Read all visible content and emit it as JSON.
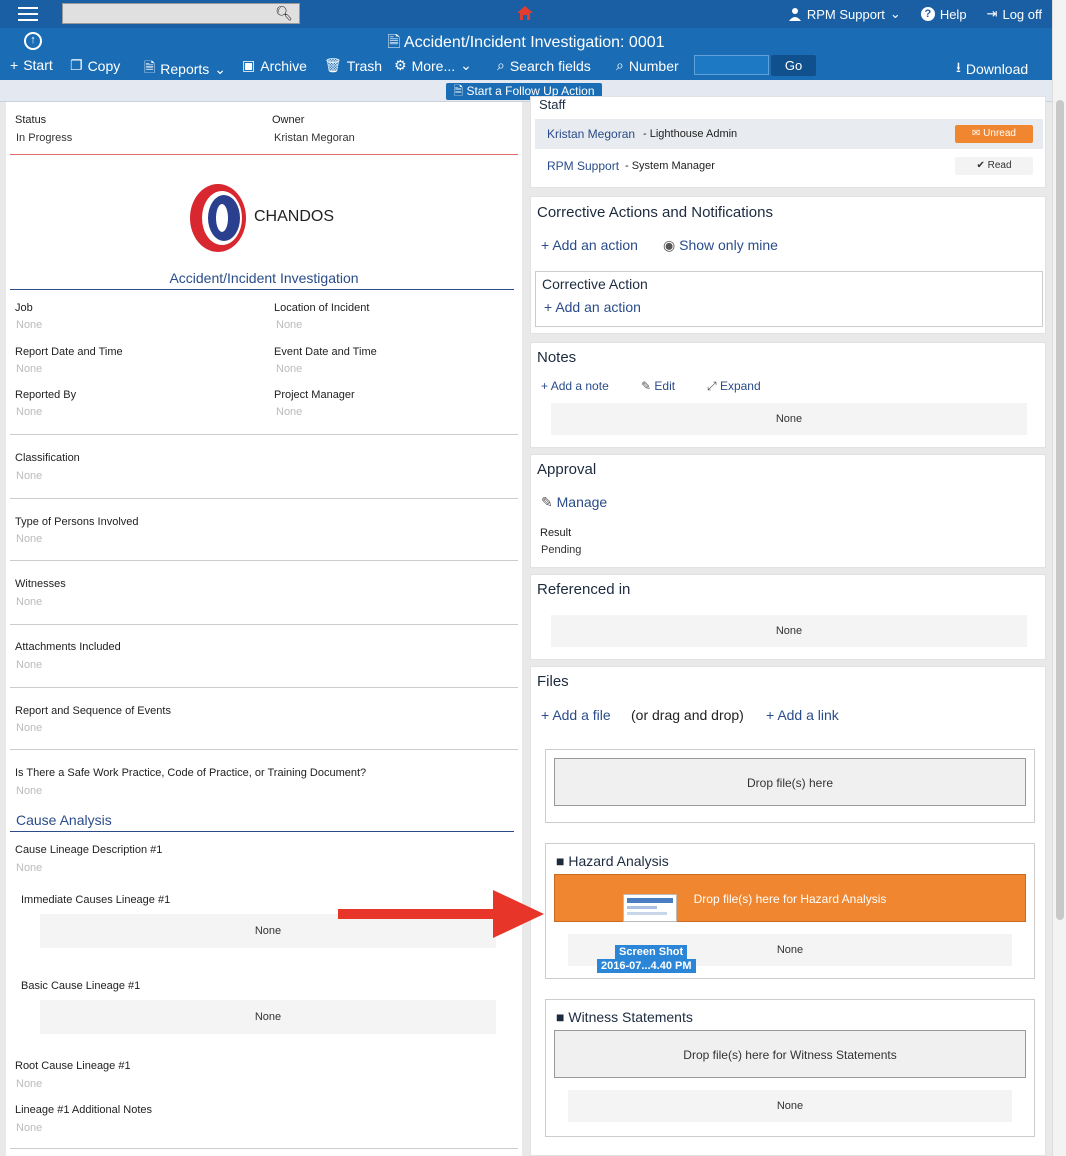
{
  "topbar": {
    "search_placeholder": "",
    "user": "RPM Support",
    "help": "Help",
    "logoff": "Log off"
  },
  "titlebar": {
    "title": "Accident/Incident Investigation: 0001"
  },
  "toolbar": {
    "start": "Start",
    "copy": "Copy",
    "reports": "Reports",
    "archive": "Archive",
    "trash": "Trash",
    "more": "More...",
    "search_fields": "Search fields",
    "number": "Number",
    "go": "Go",
    "download": "Download"
  },
  "follow_up": "Start a Follow Up Action",
  "form": {
    "status_label": "Status",
    "status_value": "In Progress",
    "owner_label": "Owner",
    "owner_value": "Kristan Megoran",
    "logo_text": "CHANDOS",
    "form_title": "Accident/Incident Investigation",
    "fields": [
      {
        "label": "Job",
        "value": "None"
      },
      {
        "label": "Location of Incident",
        "value": "None"
      },
      {
        "label": "Report Date and Time",
        "value": "None"
      },
      {
        "label": "Event Date and Time",
        "value": "None"
      },
      {
        "label": "Reported By",
        "value": "None"
      },
      {
        "label": "Project Manager",
        "value": "None"
      },
      {
        "label": "Classification",
        "value": "None"
      },
      {
        "label": "Type of Persons Involved",
        "value": "None"
      },
      {
        "label": "Witnesses",
        "value": "None"
      },
      {
        "label": "Attachments Included",
        "value": "None"
      },
      {
        "label": "Report and Sequence of Events",
        "value": "None"
      },
      {
        "label": "Is There a Safe Work Practice, Code of Practice, or Training Document?",
        "value": "None"
      }
    ],
    "cause_analysis": "Cause Analysis",
    "cause_desc_label": "Cause Lineage Description #1",
    "cause_desc_value": "None",
    "immediate_label": "Immediate Causes Lineage #1",
    "immediate_value": "None",
    "basic_label": "Basic Cause Lineage #1",
    "basic_value": "None",
    "root_label": "Root Cause Lineage #1",
    "root_value": "None",
    "notes_label": "Lineage #1 Additional Notes",
    "notes_value": "None"
  },
  "staff": {
    "title": "Staff",
    "rows": [
      {
        "name": "Kristan Megoran",
        "role": "- Lighthouse Admin",
        "status": "Unread"
      },
      {
        "name": "RPM Support",
        "role": "- System Manager",
        "status": "Read"
      }
    ]
  },
  "corrective": {
    "title": "Corrective Actions and Notifications",
    "add_action": "Add an action",
    "show_mine": "Show only mine",
    "sub_title": "Corrective Action",
    "sub_add": "Add an action"
  },
  "notes": {
    "title": "Notes",
    "add": "Add a note",
    "edit": "Edit",
    "expand": "Expand",
    "value": "None"
  },
  "approval": {
    "title": "Approval",
    "manage": "Manage",
    "result_label": "Result",
    "result_value": "Pending"
  },
  "referenced": {
    "title": "Referenced in",
    "value": "None"
  },
  "files": {
    "title": "Files",
    "add_file": "Add a file",
    "drag_hint": "(or drag and drop)",
    "add_link": "Add a link",
    "drop_main": "Drop file(s) here",
    "hazard_title": "Hazard Analysis",
    "hazard_drop": "Drop file(s) here for Hazard Analysis",
    "hazard_none": "None",
    "drag_label_1": "Screen Shot",
    "drag_label_2": "2016-07...4.40 PM",
    "witness_title": "Witness Statements",
    "witness_drop": "Drop file(s) here for Witness Statements",
    "witness_none": "None"
  },
  "colors": {
    "header": "#1a6db4",
    "accent_orange": "#f0862f",
    "arrow": "#e8352a",
    "link": "#2a4c8a"
  }
}
